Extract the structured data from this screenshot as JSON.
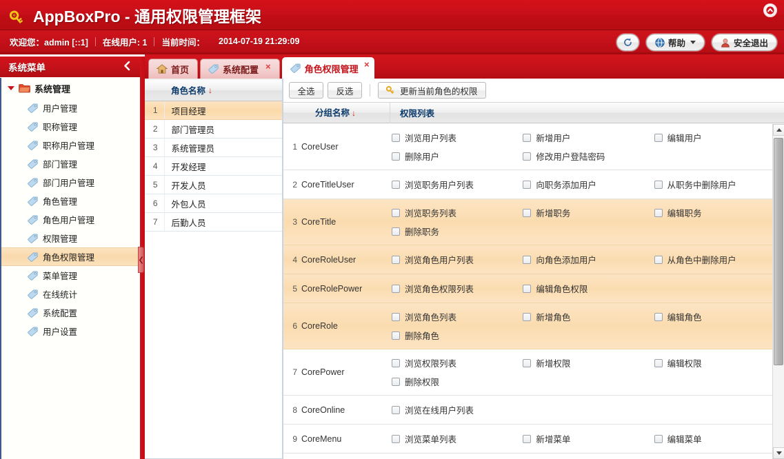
{
  "app": {
    "title": "AppBoxPro - 通用权限管理框架",
    "key_icon": "key-icon",
    "collapse_icon": "chevron-up-icon"
  },
  "infobar": {
    "welcome": "欢迎您：admin  [::1]",
    "online": "在线用户: 1",
    "time_label": "当前时间：",
    "time_value": "2014-07-19 21:29:09",
    "refresh_icon": "refresh-icon",
    "help_label": "帮助",
    "help_icon": "globe-icon",
    "logout_label": "安全退出",
    "logout_icon": "user-icon"
  },
  "sidebar": {
    "title": "系统菜单",
    "collapse_icon": "chevron-left-icon",
    "root": {
      "label": "系统管理",
      "icon": "folder-icon"
    },
    "items": [
      {
        "label": "用户管理",
        "icon": "tag-icon",
        "active": false
      },
      {
        "label": "职称管理",
        "icon": "tag-icon",
        "active": false
      },
      {
        "label": "职称用户管理",
        "icon": "tag-icon",
        "active": false
      },
      {
        "label": "部门管理",
        "icon": "tag-icon",
        "active": false
      },
      {
        "label": "部门用户管理",
        "icon": "tag-icon",
        "active": false
      },
      {
        "label": "角色管理",
        "icon": "tag-icon",
        "active": false
      },
      {
        "label": "角色用户管理",
        "icon": "tag-icon",
        "active": false
      },
      {
        "label": "权限管理",
        "icon": "tag-icon",
        "active": false
      },
      {
        "label": "角色权限管理",
        "icon": "tag-icon",
        "active": true
      },
      {
        "label": "菜单管理",
        "icon": "tag-icon",
        "active": false
      },
      {
        "label": "在线统计",
        "icon": "tag-icon",
        "active": false
      },
      {
        "label": "系统配置",
        "icon": "tag-icon",
        "active": false
      },
      {
        "label": "用户设置",
        "icon": "tag-icon",
        "active": false
      }
    ],
    "handle_icon": "chevron-left-icon"
  },
  "tabs": [
    {
      "label": "首页",
      "icon": "home-icon",
      "active": false,
      "closable": false
    },
    {
      "label": "系统配置",
      "icon": "tag-icon",
      "active": false,
      "closable": true,
      "close": "×"
    },
    {
      "label": "角色权限管理",
      "icon": "tag-icon",
      "active": true,
      "closable": true,
      "close": "×"
    }
  ],
  "role_list": {
    "header": "角色名称",
    "sort_arrow": "↓",
    "rows": [
      {
        "index": "1",
        "name": "项目经理",
        "selected": true
      },
      {
        "index": "2",
        "name": "部门管理员",
        "selected": false
      },
      {
        "index": "3",
        "name": "系统管理员",
        "selected": false
      },
      {
        "index": "4",
        "name": "开发经理",
        "selected": false
      },
      {
        "index": "5",
        "name": "开发人员",
        "selected": false
      },
      {
        "index": "6",
        "name": "外包人员",
        "selected": false
      },
      {
        "index": "7",
        "name": "后勤人员",
        "selected": false
      }
    ]
  },
  "toolbar": {
    "select_all": "全选",
    "invert": "反选",
    "update_label": "更新当前角色的权限",
    "update_icon": "key-icon"
  },
  "grid": {
    "col_group": "分组名称",
    "col_group_arrow": "↓",
    "col_perms": "权限列表",
    "rows": [
      {
        "index": "1",
        "group": "CoreUser",
        "alt": false,
        "perms": [
          "浏览用户列表",
          "新增用户",
          "编辑用户",
          "删除用户",
          "修改用户登陆密码"
        ]
      },
      {
        "index": "2",
        "group": "CoreTitleUser",
        "alt": false,
        "perms": [
          "浏览职务用户列表",
          "向职务添加用户",
          "从职务中删除用户"
        ]
      },
      {
        "index": "3",
        "group": "CoreTitle",
        "alt": true,
        "perms": [
          "浏览职务列表",
          "新增职务",
          "编辑职务",
          "删除职务"
        ]
      },
      {
        "index": "4",
        "group": "CoreRoleUser",
        "alt": true,
        "perms": [
          "浏览角色用户列表",
          "向角色添加用户",
          "从角色中删除用户"
        ]
      },
      {
        "index": "5",
        "group": "CoreRolePower",
        "alt": true,
        "perms": [
          "浏览角色权限列表",
          "编辑角色权限"
        ]
      },
      {
        "index": "6",
        "group": "CoreRole",
        "alt": true,
        "perms": [
          "浏览角色列表",
          "新增角色",
          "编辑角色",
          "删除角色"
        ]
      },
      {
        "index": "7",
        "group": "CorePower",
        "alt": false,
        "perms": [
          "浏览权限列表",
          "新增权限",
          "编辑权限",
          "删除权限"
        ]
      },
      {
        "index": "8",
        "group": "CoreOnline",
        "alt": false,
        "perms": [
          "浏览在线用户列表"
        ]
      },
      {
        "index": "9",
        "group": "CoreMenu",
        "alt": false,
        "perms": [
          "浏览菜单列表",
          "新增菜单",
          "编辑菜单"
        ]
      }
    ]
  },
  "colors": {
    "brand_red": "#c5111a",
    "dark_red": "#a30b10",
    "highlight_orange": "#fbd9a9",
    "header_blue_text": "#0b3a6b",
    "tab_active_text": "#c4121b"
  }
}
